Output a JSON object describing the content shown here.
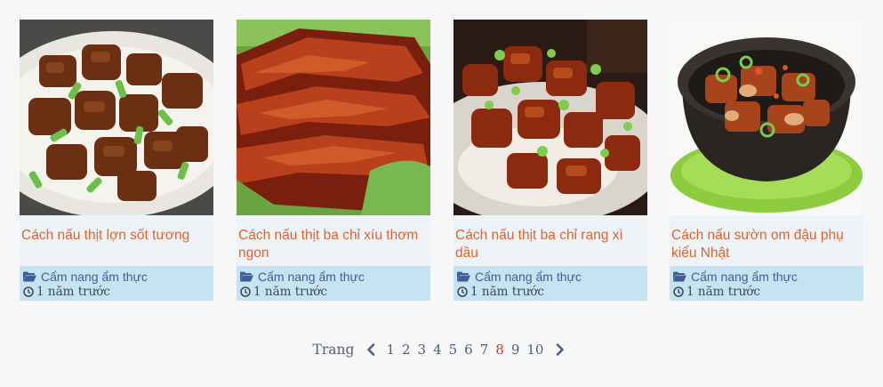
{
  "posts": [
    {
      "title": "Cách nấu thịt lợn sốt tương",
      "category": "Cẩm nang ẩm thực",
      "time": "1 năm trước",
      "image": "braised-pork-cubes-plate"
    },
    {
      "title": "Cách nấu thịt ba chỉ xíu thơm ngon",
      "category": "Cẩm nang ẩm thực",
      "time": "1 năm trước",
      "image": "char-siu-pork-belly"
    },
    {
      "title": "Cách nấu thịt ba chỉ rang xì dầu",
      "category": "Cẩm nang ẩm thực",
      "time": "1 năm trước",
      "image": "soy-sauce-pork-belly-rice"
    },
    {
      "title": "Cách nấu sườn om đậu phụ kiểu Nhật",
      "category": "Cẩm nang ẩm thực",
      "time": "1 năm trước",
      "image": "braised-ribs-tofu-clay-pot"
    }
  ],
  "pagination": {
    "label": "Trang",
    "pages": [
      "1",
      "2",
      "3",
      "4",
      "5",
      "6",
      "7",
      "8",
      "9",
      "10"
    ],
    "current": "8"
  },
  "colors": {
    "title": "#e2622a",
    "meta_background": "#c6e3f2",
    "category": "#3f5f99",
    "current_page": "#d8342a",
    "page_link": "#4a5f8a"
  },
  "icons": {
    "category": "folder-open-icon",
    "time": "clock-icon",
    "prev": "chevron-left-icon",
    "next": "chevron-right-icon"
  }
}
